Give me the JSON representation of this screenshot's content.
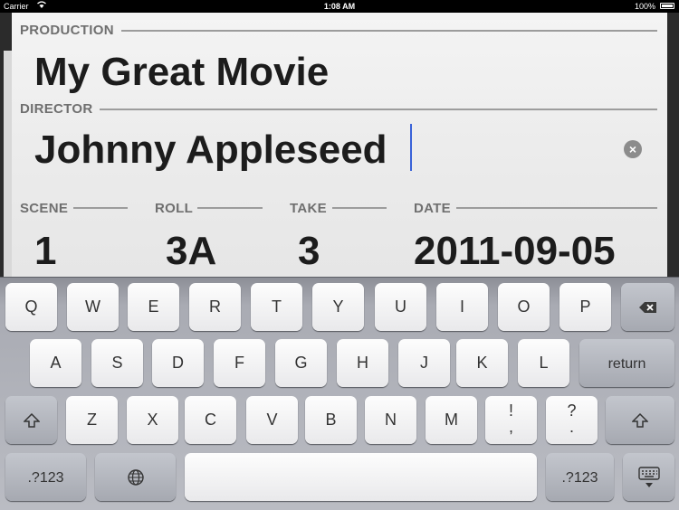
{
  "status_bar": {
    "carrier": "Carrier",
    "time": "1:08 AM",
    "battery": "100%"
  },
  "slate": {
    "production_label": "PRODUCTION",
    "production_value": "My Great Movie",
    "director_label": "DIRECTOR",
    "director_value": "Johnny Appleseed",
    "scene_label": "SCENE",
    "scene_value": "1",
    "roll_label": "ROLL",
    "roll_value": "3A",
    "take_label": "TAKE",
    "take_value": "3",
    "date_label": "DATE",
    "date_value": "2011-09-05"
  },
  "keyboard": {
    "row1": [
      "Q",
      "W",
      "E",
      "R",
      "T",
      "Y",
      "U",
      "I",
      "O",
      "P"
    ],
    "row2": [
      "A",
      "S",
      "D",
      "F",
      "G",
      "H",
      "J",
      "K",
      "L"
    ],
    "return_label": "return",
    "row3": [
      "Z",
      "X",
      "C",
      "V",
      "B",
      "N",
      "M"
    ],
    "exclaim_top": "!",
    "exclaim_bottom": ",",
    "question_top": "?",
    "question_bottom": ".",
    "numbers_label": ".?123",
    "icons": {
      "delete": "backspace-icon",
      "shift": "shift-icon",
      "globe": "globe-icon",
      "hide": "keyboard-hide-icon"
    }
  }
}
